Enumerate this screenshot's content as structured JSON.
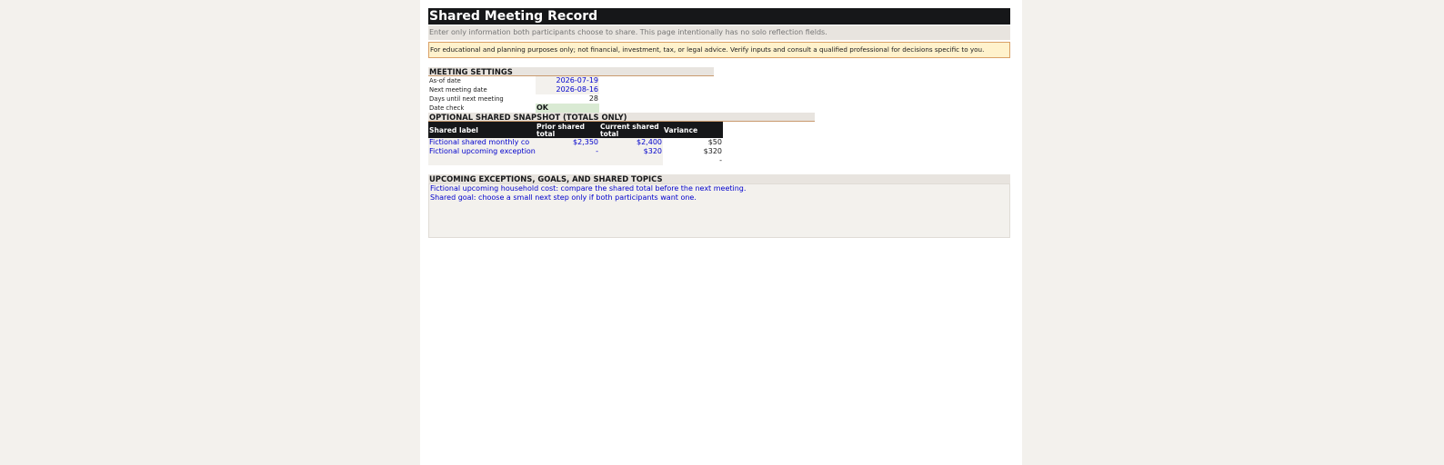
{
  "title": "Shared Meeting Record",
  "subtitle": "Enter only information both participants choose to share. This page intentionally has no solo reflection fields.",
  "disclaimer": "For educational and planning purposes only; not financial, investment, tax, or legal advice. Verify inputs and consult a qualified professional for decisions specific to you.",
  "meeting_settings": {
    "heading": "MEETING SETTINGS",
    "rows": [
      {
        "label": "As-of date",
        "value": "2026-07-19"
      },
      {
        "label": "Next meeting date",
        "value": "2026-08-16"
      },
      {
        "label": "Days until next meeting",
        "value": "28"
      },
      {
        "label": "Date check",
        "value": "OK"
      }
    ]
  },
  "snapshot": {
    "heading": "OPTIONAL SHARED SNAPSHOT (TOTALS ONLY)",
    "columns": [
      "Shared label",
      "Prior shared total",
      "Current shared total",
      "Variance"
    ],
    "rows": [
      {
        "label": "Fictional shared monthly co",
        "prior": "$2,350",
        "current": "$2,400",
        "variance": "$50"
      },
      {
        "label": "Fictional upcoming exception",
        "prior": "-",
        "current": "$320",
        "variance": "$320"
      },
      {
        "label": "",
        "prior": "",
        "current": "",
        "variance": "-"
      }
    ]
  },
  "topics": {
    "heading": "UPCOMING EXCEPTIONS, GOALS, AND SHARED TOPICS",
    "lines": [
      "Fictional upcoming household cost: compare the shared total before the next meeting.",
      "Shared goal: choose a small next step only if both participants want one."
    ]
  },
  "colors": {
    "header_dark": "#161719",
    "input_text_blue": "#0000cc",
    "section_band": "#e8e4df",
    "disclaimer_bg": "#fff2cc",
    "ok_bg": "#d9ead3"
  }
}
